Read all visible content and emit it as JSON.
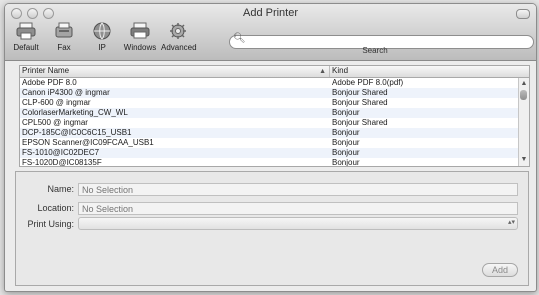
{
  "window": {
    "title": "Add Printer"
  },
  "toolbar": [
    {
      "label": "Default",
      "icon": "printer-icon"
    },
    {
      "label": "Fax",
      "icon": "fax-icon"
    },
    {
      "label": "IP",
      "icon": "globe-icon"
    },
    {
      "label": "Windows",
      "icon": "windows-printer-icon"
    },
    {
      "label": "Advanced",
      "icon": "gear-icon"
    }
  ],
  "search": {
    "label": "Search",
    "value": ""
  },
  "list": {
    "columns": {
      "name": "Printer Name",
      "kind": "Kind"
    },
    "rows": [
      {
        "name": "Adobe PDF 8.0",
        "kind": "Adobe PDF 8.0(pdf)"
      },
      {
        "name": "Canon iP4300 @ ingmar",
        "kind": "Bonjour Shared"
      },
      {
        "name": "CLP-600 @ ingmar",
        "kind": "Bonjour Shared"
      },
      {
        "name": "ColorlaserMarketing_CW_WL",
        "kind": "Bonjour"
      },
      {
        "name": "CPL500 @ ingmar",
        "kind": "Bonjour Shared"
      },
      {
        "name": "DCP-185C@IC0C6C15_USB1",
        "kind": "Bonjour"
      },
      {
        "name": "EPSON Scanner@IC09FCAA_USB1",
        "kind": "Bonjour"
      },
      {
        "name": "FS-1010@IC02DEC7",
        "kind": "Bonjour"
      },
      {
        "name": "FS-1020D@IC08135F",
        "kind": "Bonjour"
      }
    ]
  },
  "form": {
    "name_label": "Name:",
    "name_placeholder": "No Selection",
    "location_label": "Location:",
    "location_placeholder": "No Selection",
    "print_using_label": "Print Using:"
  },
  "buttons": {
    "add": "Add"
  }
}
